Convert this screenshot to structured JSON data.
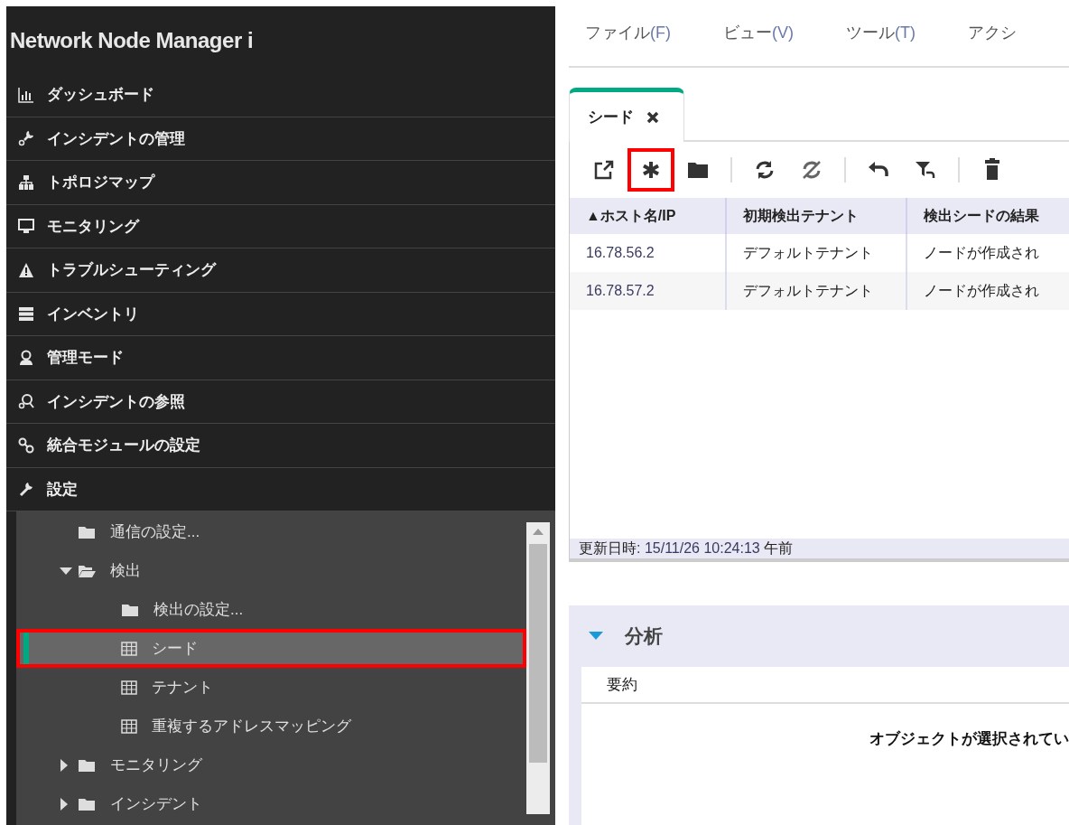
{
  "app_title": "Network Node Manager i",
  "nav": [
    {
      "label": "ダッシュボード",
      "kind": "chart"
    },
    {
      "label": "インシデントの管理",
      "kind": "wrench-drop"
    },
    {
      "label": "トポロジマップ",
      "kind": "hierarchy"
    },
    {
      "label": "モニタリング",
      "kind": "monitor"
    },
    {
      "label": "トラブルシューティング",
      "kind": "warning"
    },
    {
      "label": "インベントリ",
      "kind": "server"
    },
    {
      "label": "管理モード",
      "kind": "person"
    },
    {
      "label": "インシデントの参照",
      "kind": "search-drop"
    },
    {
      "label": "統合モジュールの設定",
      "kind": "link"
    },
    {
      "label": "設定",
      "kind": "wrench"
    }
  ],
  "tree": [
    {
      "label": "通信の設定...",
      "kind": "folder",
      "selected": false,
      "highlighted": false
    },
    {
      "label": "検出",
      "kind": "folder",
      "expanded": true,
      "selected": false,
      "highlighted": false,
      "children": [
        {
          "label": "検出の設定...",
          "kind": "folder",
          "selected": false,
          "highlighted": false
        },
        {
          "label": "シード",
          "kind": "table",
          "selected": true,
          "highlighted": true
        },
        {
          "label": "テナント",
          "kind": "table",
          "selected": false,
          "highlighted": false
        },
        {
          "label": "重複するアドレスマッピング",
          "kind": "table",
          "selected": false,
          "highlighted": false
        }
      ]
    },
    {
      "label": "モニタリング",
      "kind": "folder",
      "expanded": false,
      "selected": false,
      "highlighted": false
    },
    {
      "label": "インシデント",
      "kind": "folder",
      "expanded": false,
      "selected": false,
      "highlighted": false
    }
  ],
  "menu": [
    {
      "label": "ファイル",
      "key": "(F)"
    },
    {
      "label": "ビュー",
      "key": "(V)"
    },
    {
      "label": "ツール",
      "key": "(T)"
    },
    {
      "label": "アクシ"
    }
  ],
  "tabs": [
    {
      "label": "シード",
      "selected": true
    }
  ],
  "toolbar": [
    {
      "kind": "open-new",
      "highlighted": false
    },
    {
      "kind": "new",
      "highlighted": true
    },
    {
      "kind": "folder",
      "highlighted": false
    },
    {
      "kind": "sep"
    },
    {
      "kind": "refresh",
      "highlighted": false
    },
    {
      "kind": "refresh-off",
      "highlighted": false
    },
    {
      "kind": "sep"
    },
    {
      "kind": "undo",
      "highlighted": false
    },
    {
      "kind": "filter-undo",
      "highlighted": false
    },
    {
      "kind": "sep"
    },
    {
      "kind": "delete",
      "highlighted": false
    }
  ],
  "table": {
    "columns": [
      "▲ホスト名/IP",
      "初期検出テナント",
      "検出シードの結果"
    ],
    "rows": [
      [
        "16.78.56.2",
        "デフォルトテナント",
        "ノードが作成され"
      ],
      [
        "16.78.57.2",
        "デフォルトテナント",
        "ノードが作成され"
      ]
    ]
  },
  "status": {
    "label": "更新日時",
    "value": ": 15/11/26 10:24:13",
    "suffix": "午前"
  },
  "analysis": {
    "title": "分析",
    "expanded": true,
    "section": "要約",
    "message": "オブジェクトが選択されてい"
  }
}
